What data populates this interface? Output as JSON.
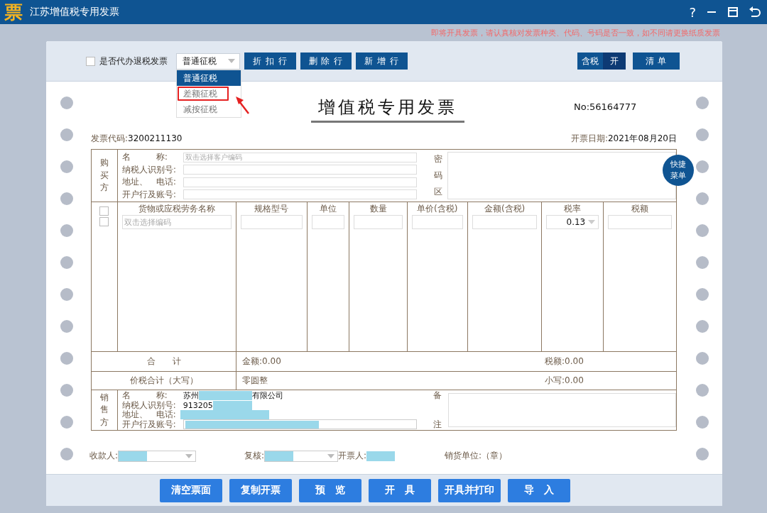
{
  "window": {
    "logo": "票",
    "title": "江苏增值税专用发票",
    "help": "?"
  },
  "notice": "即将开具发票，请认真核对发票种类、代码、号码是否一致，如不同请更换纸质发票",
  "toolbar": {
    "refund_checkbox": {
      "label": "是否代办退税发票",
      "checked": false
    },
    "tax_mode": {
      "value": "普通征税",
      "expanded": true,
      "options": [
        {
          "label": "普通征税",
          "selected": true,
          "annotated": false
        },
        {
          "label": "差额征税",
          "selected": false,
          "annotated": true
        },
        {
          "label": "减按征税",
          "selected": false,
          "annotated": false
        }
      ]
    },
    "buttons": [
      "折 扣 行",
      "删 除 行",
      "新 增 行"
    ],
    "tax_toggle": {
      "label": "含税",
      "state": "开"
    },
    "list_button": "清 单"
  },
  "invoice": {
    "title": "增值税专用发票",
    "number": "No:56164777",
    "code_label": "发票代码:",
    "code": "3200211130",
    "date_label": "开票日期:",
    "date": "2021年08月20日",
    "buyer": {
      "label": "购买方",
      "fields": [
        {
          "label": "名　　　称:",
          "placeholder": "双击选择客户编码"
        },
        {
          "label": "纳税人识别号:"
        },
        {
          "label": "地址、　电话:"
        },
        {
          "label": "开户行及账号:"
        }
      ],
      "cipher_label": "密码区"
    },
    "items": {
      "checks": [
        {
          "checked": false
        },
        {
          "checked": false
        }
      ],
      "columns": [
        {
          "header": "货物或应税劳务名称",
          "kind": "text",
          "placeholder": "双击选择编码"
        },
        {
          "header": "规格型号",
          "kind": "text"
        },
        {
          "header": "单位",
          "kind": "text"
        },
        {
          "header": "数量",
          "kind": "text"
        },
        {
          "header": "单价(含税)",
          "kind": "text"
        },
        {
          "header": "金额(含税)",
          "kind": "text"
        },
        {
          "header": "税率",
          "kind": "select",
          "value": "0.13"
        },
        {
          "header": "税额",
          "kind": "text"
        }
      ]
    },
    "totals": {
      "label": "合　　计",
      "amount": "金额:0.00",
      "tax": "税额:0.00"
    },
    "grand_total": {
      "label": "价税合计（大写）",
      "words": "零圆整",
      "small": "小写:0.00"
    },
    "seller": {
      "label": "销售方",
      "fields": [
        {
          "label": "名　　　称:",
          "value": "苏州",
          "after": "有限公司",
          "redacted": true,
          "boxed": false
        },
        {
          "label": "纳税人识别号:",
          "value": "913205",
          "redacted": true,
          "boxed": false
        },
        {
          "label": "地址、　电话:",
          "redacted": true,
          "boxed": false
        },
        {
          "label": "开户行及账号:",
          "redacted": true,
          "boxed": true
        }
      ],
      "remarks_label": "备注"
    }
  },
  "signatures": [
    {
      "label": "收款人:",
      "kind": "select"
    },
    {
      "label": "复核:",
      "kind": "select"
    },
    {
      "label": "开票人:",
      "kind": "text"
    },
    {
      "label": "销货单位:（章）",
      "kind": "plain"
    }
  ],
  "quick_menu": "快捷菜单",
  "actions": [
    "清空票面",
    "复制开票",
    "预　览",
    "开　具",
    "开具并打印",
    "导　入"
  ]
}
